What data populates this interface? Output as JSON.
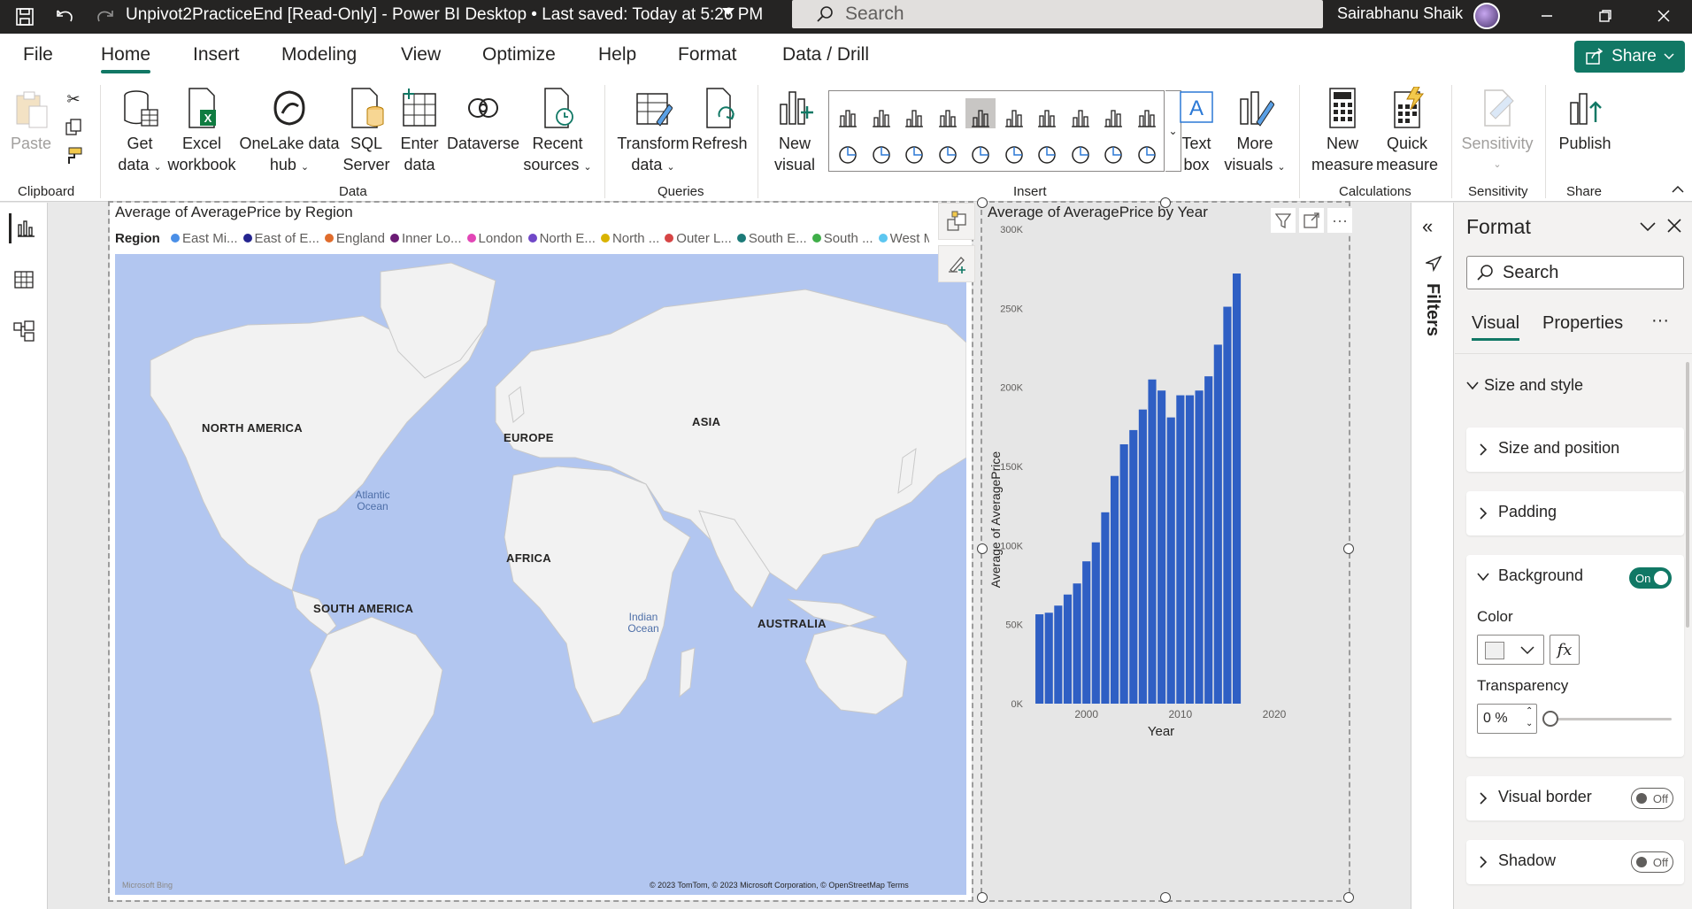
{
  "title_bar": {
    "document_title": "Unpivot2PracticeEnd [Read-Only] - Power BI Desktop • Last saved: Today at 5:26 PM",
    "search_placeholder": "Search",
    "user_name": "Sairabhanu Shaik"
  },
  "menu": {
    "tabs": [
      "File",
      "Home",
      "Insert",
      "Modeling",
      "View",
      "Optimize",
      "Help",
      "Format",
      "Data / Drill"
    ],
    "active_tab": "Home",
    "share_label": "Share"
  },
  "ribbon": {
    "clipboard": {
      "paste": "Paste",
      "group_label": "Clipboard"
    },
    "data": {
      "get_data": [
        "Get",
        "data"
      ],
      "excel": [
        "Excel",
        "workbook"
      ],
      "onelake": [
        "OneLake data",
        "hub"
      ],
      "sql": [
        "SQL",
        "Server"
      ],
      "enter": [
        "Enter",
        "data"
      ],
      "dataverse": "Dataverse",
      "recent": [
        "Recent",
        "sources"
      ],
      "group_label": "Data"
    },
    "queries": {
      "transform": [
        "Transform",
        "data"
      ],
      "refresh": "Refresh",
      "group_label": "Queries"
    },
    "insert": {
      "new_visual": [
        "New",
        "visual"
      ],
      "text_box": [
        "Text",
        "box"
      ],
      "more_visuals": [
        "More",
        "visuals"
      ],
      "group_label": "Insert"
    },
    "calculations": {
      "new_measure": [
        "New",
        "measure"
      ],
      "quick_measure": [
        "Quick",
        "measure"
      ],
      "group_label": "Calculations"
    },
    "sensitivity": {
      "label": "Sensitivity",
      "group_label": "Sensitivity"
    },
    "share": {
      "publish": "Publish",
      "group_label": "Share"
    }
  },
  "map_visual": {
    "title": "Average of AveragePrice by Region",
    "legend_title": "Region",
    "legend_items": [
      {
        "label": "East Mi...",
        "color": "#4a8fe7"
      },
      {
        "label": "East of E...",
        "color": "#24248f"
      },
      {
        "label": "England",
        "color": "#e06c2c"
      },
      {
        "label": "Inner Lo...",
        "color": "#6b1b74"
      },
      {
        "label": "London",
        "color": "#e246b6"
      },
      {
        "label": "North E...",
        "color": "#7048c8"
      },
      {
        "label": "North ...",
        "color": "#d9b300"
      },
      {
        "label": "Outer L...",
        "color": "#d64545"
      },
      {
        "label": "South E...",
        "color": "#1c7a78"
      },
      {
        "label": "South ...",
        "color": "#3fae49"
      },
      {
        "label": "West Mi...",
        "color": "#5cc6f0"
      }
    ],
    "continent_labels": [
      "NORTH AMERICA",
      "EUROPE",
      "ASIA",
      "AFRICA",
      "SOUTH AMERICA",
      "AUSTRALIA"
    ],
    "ocean_labels": [
      "Atlantic Ocean",
      "Indian Ocean"
    ],
    "copyright": "© 2023 TomTom, © 2023 Microsoft Corporation, © OpenStreetMap  Terms",
    "bing_logo": "Microsoft Bing"
  },
  "bar_visual": {
    "title": "Average of AveragePrice by Year"
  },
  "chart_data": {
    "type": "bar",
    "title": "Average of AveragePrice by Year",
    "xlabel": "Year",
    "ylabel": "Average of AveragePrice",
    "x": [
      1995,
      1996,
      1997,
      1998,
      1999,
      2000,
      2001,
      2002,
      2003,
      2004,
      2005,
      2006,
      2007,
      2008,
      2009,
      2010,
      2011,
      2012,
      2013,
      2014,
      2015,
      2016
    ],
    "values": [
      56500,
      57500,
      62000,
      69000,
      76000,
      90000,
      102000,
      121000,
      144000,
      164000,
      173000,
      186000,
      205000,
      198000,
      181000,
      195000,
      195000,
      198000,
      207000,
      227000,
      251000,
      272000
    ],
    "xlim": [
      1994,
      2020
    ],
    "ylim": [
      0,
      300000
    ],
    "x_ticks": [
      2000,
      2010,
      2020
    ],
    "y_ticks": [
      0,
      50000,
      100000,
      150000,
      200000,
      250000,
      300000
    ],
    "y_tick_labels": [
      "0K",
      "50K",
      "100K",
      "150K",
      "200K",
      "250K",
      "300K"
    ],
    "color": "#2f5fc4",
    "grid": false
  },
  "filters_pane": {
    "label": "Filters"
  },
  "format_pane": {
    "title": "Format",
    "search_placeholder": "Search",
    "tabs": [
      "Visual",
      "Properties"
    ],
    "active_tab": "Visual",
    "section": "Size and style",
    "cards": {
      "size_position": "Size and position",
      "padding": "Padding",
      "background": "Background",
      "background_toggle": "On",
      "color_label": "Color",
      "color_value": "#f0f0f0",
      "transparency_label": "Transparency",
      "transparency_value": "0 %",
      "visual_border": "Visual border",
      "visual_border_toggle": "Off",
      "shadow": "Shadow",
      "shadow_toggle": "Off"
    }
  },
  "colors": {
    "accent": "#117865",
    "bar": "#2f5fc4",
    "map_water": "#b2c6f0",
    "map_land": "#f2f2f2"
  }
}
